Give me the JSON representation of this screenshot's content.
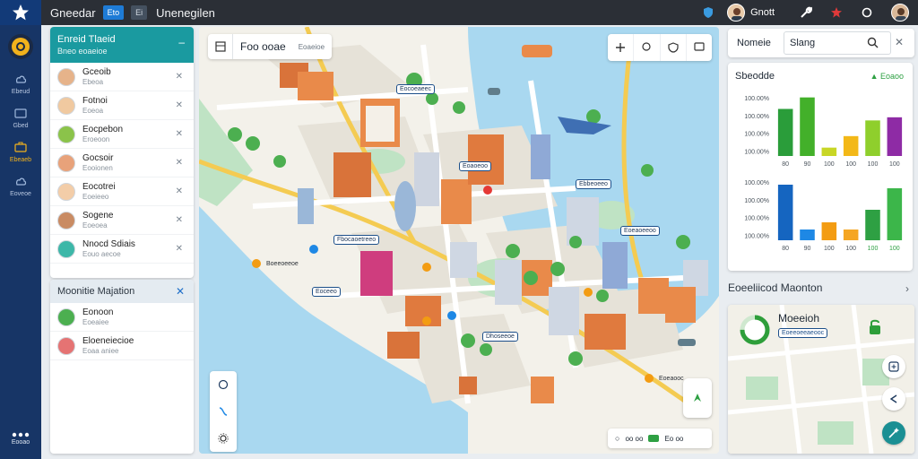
{
  "app": {
    "title": "Gneedar",
    "chip_primary": "Eto",
    "chip_secondary": "Ei",
    "subtitle": "Unenegilen",
    "user_name": "Gnott"
  },
  "rail": {
    "items": [
      {
        "label": "Ebeud",
        "icon": "cloud-icon"
      },
      {
        "label": "Gbed",
        "icon": "folder-icon"
      },
      {
        "label": "Ebeaeb",
        "icon": "briefcase-icon"
      },
      {
        "label": "Eoveoe",
        "icon": "cloud-upload-icon"
      }
    ],
    "more_label": "Eooao"
  },
  "contacts": {
    "title": "Enreid Tlaeid",
    "subtitle": "Bneo eoaeioe",
    "items": [
      {
        "name": "Gceoib",
        "sub": "Ebeoa"
      },
      {
        "name": "Fotnoi",
        "sub": "Eoeoa"
      },
      {
        "name": "Eocpebon",
        "sub": "Eroeoon"
      },
      {
        "name": "Gocsoir",
        "sub": "Eooionen"
      },
      {
        "name": "Eocotrei",
        "sub": "Eoeieeo"
      },
      {
        "name": "Sogene",
        "sub": "Eoeoea"
      },
      {
        "name": "Nnocd Sdiais",
        "sub": "Eouo aecoe"
      }
    ]
  },
  "members": {
    "title": "Moonitie Majation",
    "items": [
      {
        "name": "Eonoon",
        "sub": "Eoeaiee"
      },
      {
        "name": "Eloeneiecioe",
        "sub": "Eoaa aniee"
      }
    ]
  },
  "map": {
    "search_text": "Foo ooae",
    "search_tag": "Eoaeioe",
    "status_left": "oo oo",
    "status_right": "Eo oo",
    "labels": [
      "Eocoeaeec",
      "Eoaoeoo",
      "Fbocaoetreeo",
      "Boeeoeeoe",
      "Eoceeo",
      "Ebbeoeeo",
      "Eoeaoeeoo",
      "Dhoseeoe",
      "Eoeaooc"
    ]
  },
  "right_search": {
    "label": "Nomeie",
    "value": "Slang"
  },
  "stats": {
    "title": "Sbeodde",
    "trend": "▲ Eoaoo"
  },
  "chart_data": [
    {
      "type": "bar",
      "ylabel_ticks": [
        "100.00%",
        "100.00%",
        "100.00%",
        "100.00%"
      ],
      "categories": [
        "80",
        "90",
        "100",
        "100",
        "100",
        "100"
      ],
      "values": [
        45,
        56,
        8,
        19,
        34,
        37
      ],
      "colors": [
        "#2a9d3a",
        "#43b02a",
        "#c8d626",
        "#f3b818",
        "#8fcf2c",
        "#8e2ba5"
      ],
      "ylim": [
        0,
        60
      ]
    },
    {
      "type": "bar",
      "ylabel_ticks": [
        "100.00%",
        "100.00%",
        "100.00%",
        "100.00%"
      ],
      "categories": [
        "80",
        "90",
        "100",
        "100",
        "100",
        "100"
      ],
      "values": [
        62,
        12,
        20,
        12,
        34,
        58
      ],
      "colors": [
        "#1565c0",
        "#1e88e5",
        "#f39c12",
        "#f5a623",
        "#2ea043",
        "#3cb64a"
      ],
      "ylim": [
        0,
        70
      ]
    }
  ],
  "recent": {
    "header": "Eoeeliicod Maonton",
    "title": "Moeeioh",
    "sub": "Eoeeoeeaeooc"
  },
  "colors": {
    "rail": "#173566",
    "topbar": "#2b2f36",
    "accent": "#1a9aa0",
    "water": "#a9d8f0"
  }
}
